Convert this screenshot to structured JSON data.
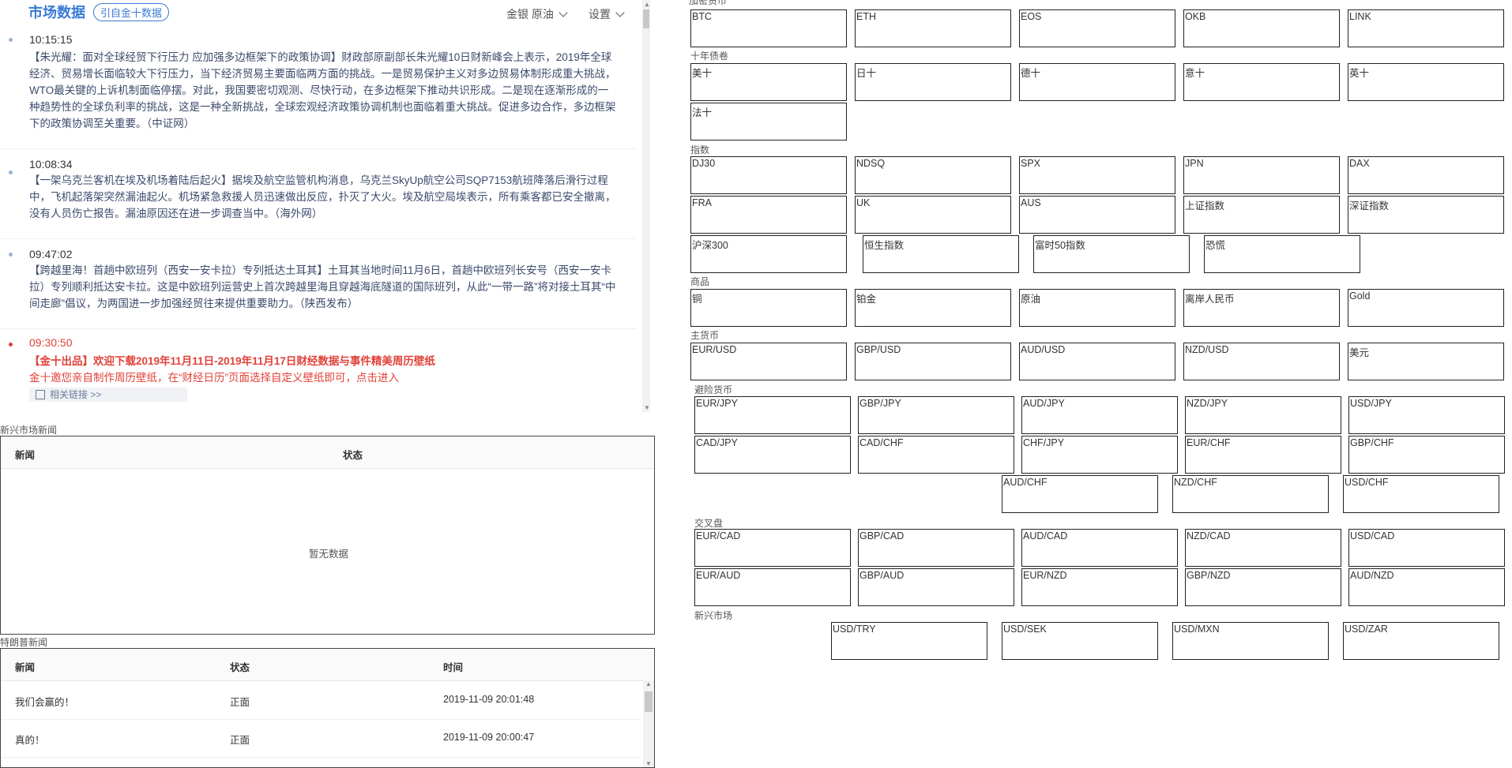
{
  "news_panel": {
    "title": "市场数据",
    "source_badge": "引自金十数据",
    "menu_filter": "金银 原油",
    "menu_settings": "设置",
    "items": [
      {
        "time": "10:15:15",
        "text": "【朱光耀：面对全球经贸下行压力 应加强多边框架下的政策协调】财政部原副部长朱光耀10日财新峰会上表示，2019年全球经济、贸易增长面临较大下行压力，当下经济贸易主要面临两方面的挑战。一是贸易保护主义对多边贸易体制形成重大挑战，WTO最关键的上诉机制面临停摆。对此，我国要密切观测、尽快行动，在多边框架下推动共识形成。二是现在逐渐形成的一种趋势性的全球负利率的挑战，这是一种全新挑战，全球宏观经济政策协调机制也面临着重大挑战。促进多边合作，多边框架下的政策协调至关重要。（中证网）"
      },
      {
        "time": "10:08:34",
        "text": "【一架乌克兰客机在埃及机场着陆后起火】据埃及航空监管机构消息，乌克兰SkyUp航空公司SQP7153航班降落后滑行过程中，飞机起落架突然漏油起火。机场紧急救援人员迅速做出反应，扑灭了大火。埃及航空局埃表示，所有乘客都已安全撤离，没有人员伤亡报告。漏油原因还在进一步调查当中。（海外网）"
      },
      {
        "time": "09:47:02",
        "text": "【跨越里海！首趟中欧班列（西安一安卡拉）专列抵达土耳其】土耳其当地时间11月6日，首趟中欧班列长安号（西安一安卡拉）专列顺利抵达安卡拉。这是中欧班列运营史上首次跨越里海且穿越海底隧道的国际班列，从此“一带一路”将对接土耳其“中间走廊”倡议，为两国进一步加强经贸往来提供重要助力。（陕西发布）"
      },
      {
        "time": "09:30:50",
        "title": "【金十出品】欢迎下载2019年11月11日-2019年11月17日财经数据与事件精美周历壁纸",
        "sub": "金十邀您亲自制作周历壁纸，在“财经日历”页面选择自定义壁纸即可，点击进入",
        "link": "相关链接 >>"
      }
    ]
  },
  "emerging_news": {
    "label": "新兴市场新闻",
    "col_news": "新闻",
    "col_status": "状态",
    "empty": "暂无数据"
  },
  "trump_news": {
    "label": "特朗普新闻",
    "col_news": "新闻",
    "col_status": "状态",
    "col_time": "时间",
    "rows": [
      {
        "news": "我们会赢的！",
        "status": "正面",
        "time": "2019-11-09 20:01:48"
      },
      {
        "news": "真的！",
        "status": "正面",
        "time": "2019-11-09 20:00:47"
      }
    ]
  },
  "quotes": {
    "crypto_label": "加密货币",
    "crypto": [
      "BTC",
      "ETH",
      "EOS",
      "OKB",
      "LINK"
    ],
    "bonds_label": "十年债卷",
    "bonds": [
      "美十",
      "日十",
      "德十",
      "意十",
      "英十",
      "法十"
    ],
    "indices_label": "指数",
    "indices_row1": [
      "DJ30",
      "NDSQ",
      "SPX",
      "JPN",
      "DAX"
    ],
    "indices_row2": [
      "FRA",
      "UK",
      "AUS",
      "上证指数",
      "深证指数"
    ],
    "indices_row3": [
      "沪深300",
      "恒生指数",
      "富时50指数",
      "恐慌"
    ],
    "commodities_label": "商品",
    "commodities": [
      "铜",
      "铂金",
      "原油",
      "离岸人民币",
      "Gold"
    ],
    "majors_label": "主货币",
    "majors": [
      "EUR/USD",
      "GBP/USD",
      "AUD/USD",
      "NZD/USD",
      "美元"
    ],
    "safe_label": "避险货币",
    "safe_row1": [
      "EUR/JPY",
      "GBP/JPY",
      "AUD/JPY",
      "NZD/JPY",
      "USD/JPY"
    ],
    "safe_row2": [
      "CAD/JPY",
      "CAD/CHF",
      "CHF/JPY",
      "EUR/CHF",
      "GBP/CHF"
    ],
    "safe_row3": [
      "AUD/CHF",
      "NZD/CHF",
      "USD/CHF"
    ],
    "cross_label": "交叉盘",
    "cross_row1": [
      "EUR/CAD",
      "GBP/CAD",
      "AUD/CAD",
      "NZD/CAD",
      "USD/CAD"
    ],
    "cross_row2": [
      "EUR/AUD",
      "GBP/AUD",
      "EUR/NZD",
      "GBP/NZD",
      "AUD/NZD"
    ],
    "emerging_label": "新兴市场",
    "emerging": [
      "USD/TRY",
      "USD/SEK",
      "USD/MXN",
      "USD/ZAR"
    ]
  }
}
